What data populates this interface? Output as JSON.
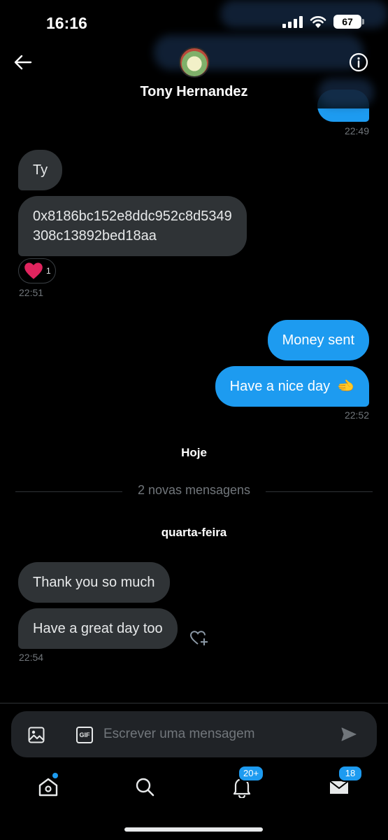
{
  "status_bar": {
    "time": "16:16",
    "battery": "67"
  },
  "header": {
    "contact_name": "Tony Hernandez",
    "avatar_icon": "avatar-image",
    "back_icon": "arrow-left-icon",
    "info_icon": "info-icon"
  },
  "messages_top": [
    {
      "time": "22:49"
    }
  ],
  "block_1": {
    "bubble_ty": "Ty",
    "bubble_hash_line1": "0x8186bc152e8ddc952c8d5349",
    "bubble_hash_line2": "308c13892bed18aa",
    "reaction_icon": "heart-icon",
    "reaction_count": "1",
    "time": "22:51"
  },
  "block_2": {
    "bubble_money": "Money sent",
    "bubble_nice_day": "Have a nice day",
    "emoji": "🫲",
    "time": "22:52"
  },
  "day_today": "Hoje",
  "new_messages": "2 novas mensagens",
  "day_wednesday": "quarta-feira",
  "block_3": {
    "bubble_thanks": "Thank you so much",
    "bubble_great_day": "Have a great day too",
    "time": "22:54"
  },
  "composer": {
    "placeholder": "Escrever uma mensagem",
    "image_icon": "image-icon",
    "gif_label": "GIF",
    "send_icon": "send-icon"
  },
  "tabbar": {
    "notifications_badge": "20+",
    "messages_badge": "18"
  },
  "colors": {
    "accent": "#1d9bf0",
    "bubble_in": "#2f3336",
    "background": "#000000"
  }
}
